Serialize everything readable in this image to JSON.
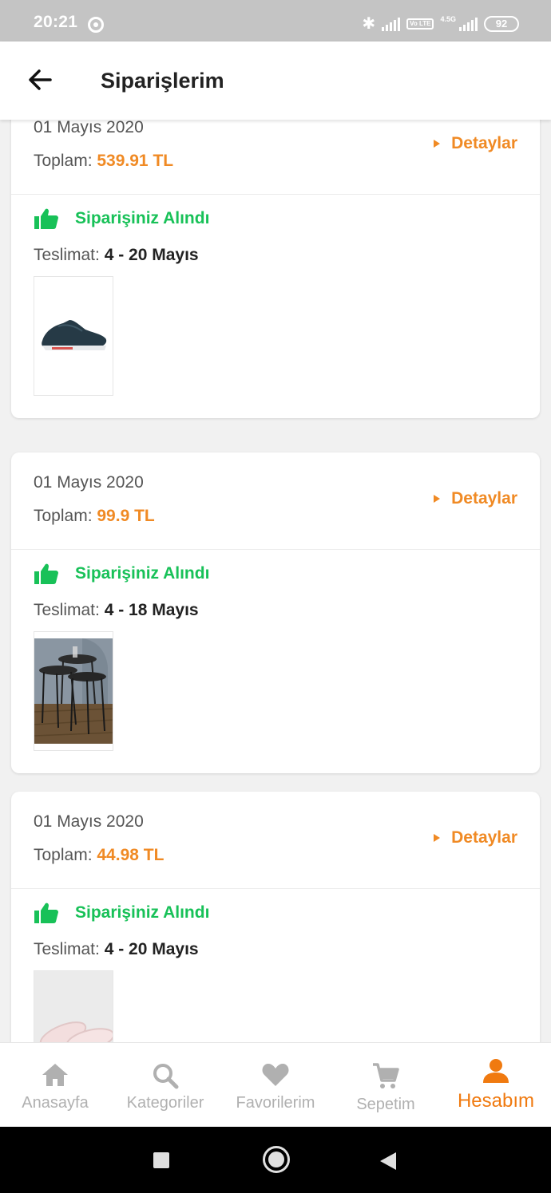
{
  "status_bar": {
    "time": "20:21",
    "network": "4.5G",
    "volte": "Vo LTE",
    "battery": "92",
    "bluetooth_icon": "bluetooth-icon"
  },
  "header": {
    "title": "Siparişlerim",
    "back_icon": "arrow-left-icon"
  },
  "orders": [
    {
      "date": "01 Mayıs 2020",
      "total_label": "Toplam: ",
      "total": "539.91 TL",
      "details": "Detaylar",
      "status": "Siparişiniz Alındı",
      "delivery_label": "Teslimat: ",
      "delivery": "4 - 20 Mayıs",
      "product_image": "running-shoe"
    },
    {
      "date": "01 Mayıs 2020",
      "total_label": "Toplam: ",
      "total": "99.9 TL",
      "details": "Detaylar",
      "status": "Siparişiniz Alındı",
      "delivery_label": "Teslimat: ",
      "delivery": "4 - 18 Mayıs",
      "product_image": "nesting-tables"
    },
    {
      "date": "01 Mayıs 2020",
      "total_label": "Toplam: ",
      "total": "44.98 TL",
      "details": "Detaylar",
      "status": "Siparişiniz Alındı",
      "delivery_label": "Teslimat: ",
      "delivery": "4 - 20 Mayıs",
      "product_image": "slippers"
    }
  ],
  "bottom_nav": [
    {
      "label": "Anasayfa",
      "icon": "home-icon",
      "active": false
    },
    {
      "label": "Kategoriler",
      "icon": "search-icon",
      "active": false
    },
    {
      "label": "Favorilerim",
      "icon": "heart-icon",
      "active": false
    },
    {
      "label": "Sepetim",
      "icon": "cart-icon",
      "active": false
    },
    {
      "label": "Hesabım",
      "icon": "person-icon",
      "active": true
    }
  ],
  "colors": {
    "accent": "#f08a24",
    "success": "#18c158",
    "inactive": "#b0b0b0",
    "active_nav": "#f07a10"
  }
}
